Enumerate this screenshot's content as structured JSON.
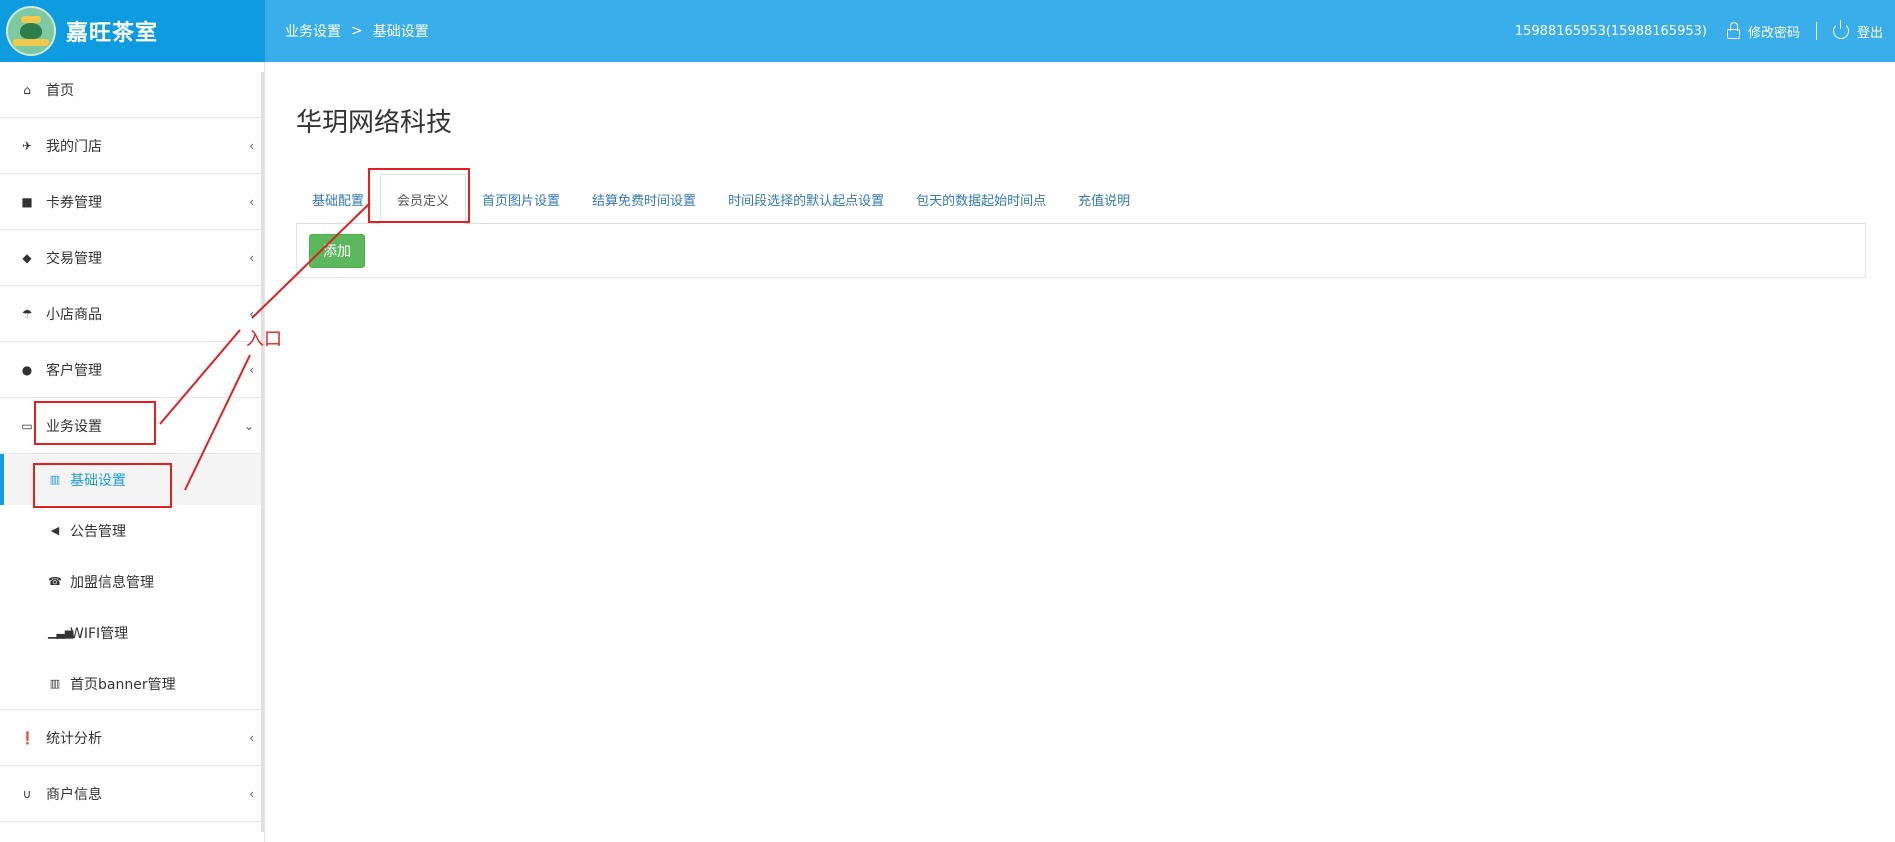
{
  "brand": {
    "name": "嘉旺茶室"
  },
  "breadcrumb": {
    "parent": "业务设置",
    "separator": ">",
    "current": "基础设置"
  },
  "header": {
    "account": "15988165953(15988165953)",
    "change_password": "修改密码",
    "logout": "登出"
  },
  "sidebar": {
    "items": [
      {
        "label": "首页",
        "icon": "home-icon"
      },
      {
        "label": "我的门店",
        "icon": "plane-icon"
      },
      {
        "label": "卡券管理",
        "icon": "folder-icon"
      },
      {
        "label": "交易管理",
        "icon": "tags-icon"
      },
      {
        "label": "小店商品",
        "icon": "umbrella-icon"
      },
      {
        "label": "客户管理",
        "icon": "user-icon"
      },
      {
        "label": "业务设置",
        "icon": "inbox-icon"
      },
      {
        "label": "统计分析",
        "icon": "exclamation-icon"
      },
      {
        "label": "商户信息",
        "icon": "magnet-icon"
      }
    ],
    "subitems": [
      {
        "label": "基础设置",
        "icon": "barcode-icon"
      },
      {
        "label": "公告管理",
        "icon": "volume-icon"
      },
      {
        "label": "加盟信息管理",
        "icon": "phone-icon"
      },
      {
        "label": "WIFI管理",
        "icon": "bar-chart-icon"
      },
      {
        "label": "首页banner管理",
        "icon": "barcode-icon"
      }
    ]
  },
  "main": {
    "title": "华玥网络科技",
    "tabs": [
      "基础配置",
      "会员定义",
      "首页图片设置",
      "结算免费时间设置",
      "时间段选择的默认起点设置",
      "包天的数据起始时间点",
      "充值说明"
    ],
    "add_button": "添加"
  },
  "annotation": {
    "label": "入口",
    "color": "#e32020"
  }
}
